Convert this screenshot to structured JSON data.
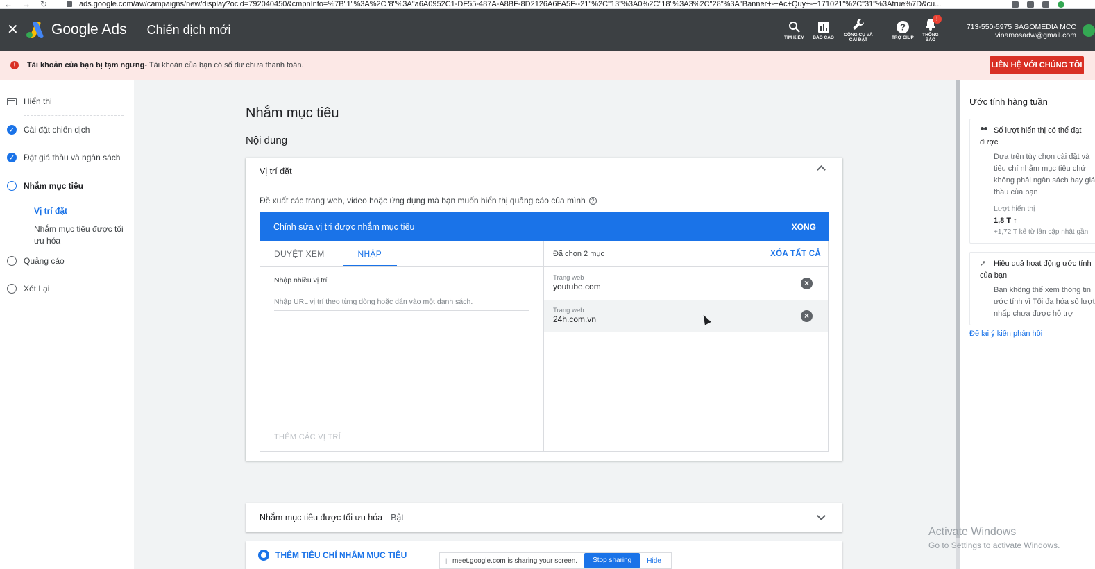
{
  "browser": {
    "url": "ads.google.com/aw/campaigns/new/display?ocid=792040450&cmpnInfo=%7B\"1\"%3A%2C\"8\"%3A\"a6A0952C1-DF55-487A-A8BF-8D2126A6FA5F--21\"%2C\"13\"%3A0%2C\"18\"%3A3%2C\"28\"%3A\"Banner+-+Ac+Quy+-+171021\"%2C\"31\"%3Atrue%7D&cu..."
  },
  "header": {
    "close_icon": "close-icon",
    "logo_text": "Google Ads",
    "campaign_title": "Chiến dịch mới",
    "tools": [
      {
        "label": "TÌM KIẾM",
        "icon": "search-icon"
      },
      {
        "label": "BÁO CÁO",
        "icon": "report-icon"
      },
      {
        "label": "CÔNG CỤ VÀ CÀI ĐẶT",
        "icon": "wrench-icon"
      },
      {
        "label": "TRỢ GIÚP",
        "icon": "help-icon"
      },
      {
        "label": "THÔNG BÁO",
        "icon": "bell-icon",
        "badge": "!"
      }
    ],
    "account_id": "713-550-5975 SAGOMEDIA MCC",
    "account_email": "vinamosadw@gmail.com"
  },
  "alert": {
    "strong": "Tài khoản của bạn bị tạm ngưng",
    "text": " - Tài khoản của bạn có số dư chưa thanh toán.",
    "button": "LIÊN HỆ VỚI CHÚNG TÔI",
    "color": "#d93025"
  },
  "sidebar": {
    "steps": [
      {
        "label": "Hiển thị",
        "status": "display"
      },
      {
        "label": "Cài đặt chiến dịch",
        "status": "done"
      },
      {
        "label": "Đặt giá thầu và ngân sách",
        "status": "done"
      },
      {
        "label": "Nhắm mục tiêu",
        "status": "current"
      },
      {
        "label": "Quảng cáo",
        "status": "todo"
      },
      {
        "label": "Xét Lại",
        "status": "todo"
      }
    ],
    "substeps": [
      {
        "label": "Vị trí đặt",
        "active": true
      },
      {
        "label": "Nhắm mục tiêu được tối ưu hóa",
        "active": false
      }
    ]
  },
  "main": {
    "title": "Nhắm mục tiêu",
    "subtitle": "Nội dung",
    "placements_card": {
      "header": "Vị trí đặt",
      "description": "Đề xuất các trang web, video hoặc ứng dụng mà bạn muốn hiển thị quảng cáo của mình",
      "edit_bar_title": "Chỉnh sửa vị trí được nhắm mục tiêu",
      "done_button": "XONG",
      "tabs": [
        {
          "label": "DUYỆT XEM",
          "active": false
        },
        {
          "label": "NHẬP",
          "active": true
        }
      ],
      "input_label": "Nhập nhiều vị trí",
      "input_placeholder": "Nhập URL vị trí theo từng dòng hoặc dán vào một danh sách.",
      "add_button": "THÊM CÁC VỊ TRÍ",
      "selected_count": "Đã chọn 2 mục",
      "clear_all": "XÓA TẤT CẢ",
      "selected_items": [
        {
          "type": "Trang web",
          "value": "youtube.com"
        },
        {
          "type": "Trang web",
          "value": "24h.com.vn"
        }
      ]
    },
    "optimized_card": {
      "label": "Nhắm mục tiêu được tối ưu hóa",
      "state": "Bật"
    },
    "add_criteria": "THÊM TIÊU CHÍ NHẮM MỤC TIÊU"
  },
  "screen_share": {
    "text": "meet.google.com is sharing your screen.",
    "stop": "Stop sharing",
    "hide": "Hide"
  },
  "right_panel": {
    "title": "Ước tính hàng tuần",
    "card1": {
      "heading": "Số lượt hiển thị có thể đạt được",
      "body": "Dựa trên tùy chọn cài đặt và tiêu chí nhắm mục tiêu chứ không phải ngân sách hay giá thầu của bạn",
      "metric_label": "Lượt hiển thị",
      "metric_value": "1,8 T",
      "metric_delta": "+1,72 T kể từ lần cập nhật gần"
    },
    "card2": {
      "heading": "Hiệu quả hoạt động ước tính của bạn",
      "body": "Bạn không thể xem thông tin ước tính vì Tối đa hóa số lượt nhấp chưa được hỗ trợ"
    },
    "feedback_link": "Để lại ý kiến phản hồi"
  },
  "watermark": {
    "line1": "Activate Windows",
    "line2": "Go to Settings to activate Windows."
  }
}
